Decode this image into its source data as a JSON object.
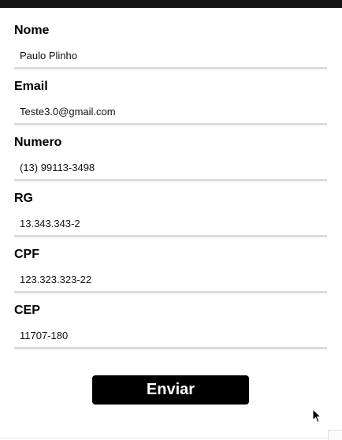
{
  "form": {
    "fields": [
      {
        "label": "Nome",
        "value": "Paulo Plinho"
      },
      {
        "label": "Email",
        "value": "Teste3.0@gmail.com"
      },
      {
        "label": "Numero",
        "value": "(13) 99113-3498"
      },
      {
        "label": "RG",
        "value": "13.343.343-2"
      },
      {
        "label": "CPF",
        "value": "123.323.323-22"
      },
      {
        "label": "CEP",
        "value": "11707-180"
      }
    ],
    "submit_label": "Enviar"
  },
  "icons": {
    "cursor": "mouse-pointer-icon"
  },
  "colors": {
    "top_bar": "#141414",
    "button_bg": "#000000",
    "button_text": "#ffffff",
    "input_underline": "#dcdcdc"
  }
}
